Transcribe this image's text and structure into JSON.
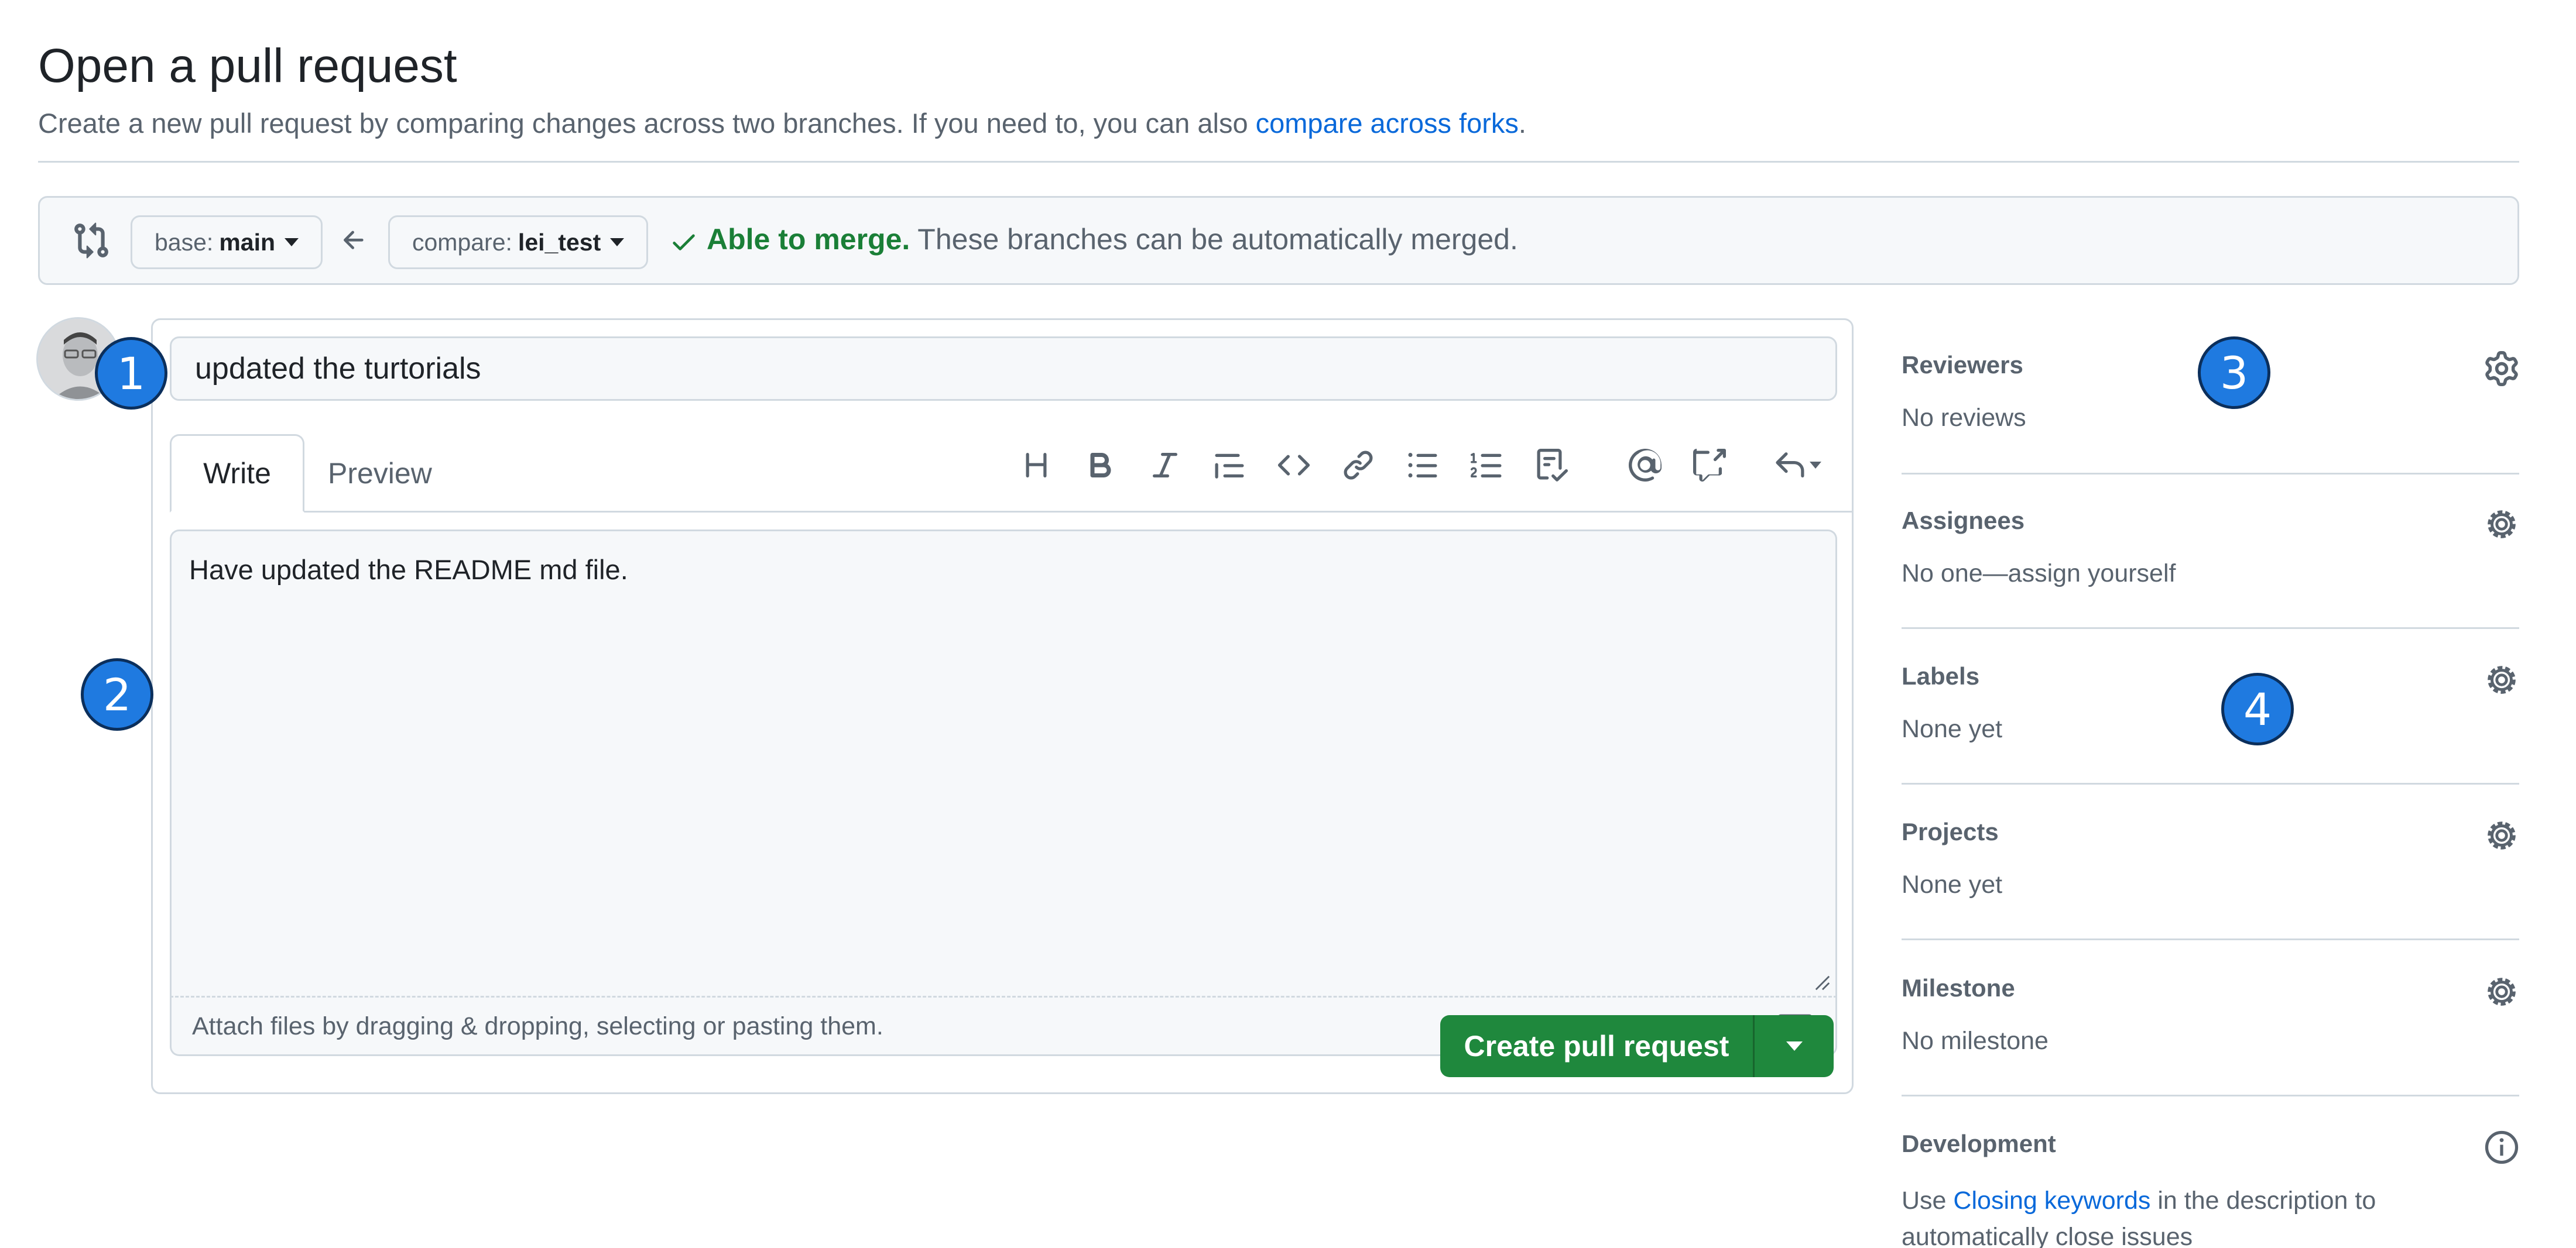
{
  "header": {
    "title": "Open a pull request",
    "subtitle": "Create a new pull request by comparing changes across two branches. If you need to, you can also ",
    "subtitle_link": "compare across forks",
    "subtitle_end": "."
  },
  "compare": {
    "base_label": "base:",
    "base_branch": "main",
    "compare_label": "compare:",
    "compare_branch": "lei_test",
    "merge_ok": "Able to merge.",
    "merge_msg": "These branches can be automatically merged."
  },
  "editor": {
    "title_value": "updated the turtorials",
    "tabs": [
      "Write",
      "Preview"
    ],
    "toolbar": [
      "heading-icon",
      "bold-icon",
      "italic-icon",
      "quote-icon",
      "code-icon",
      "link-icon",
      "unordered-list-icon",
      "ordered-list-icon",
      "task-list-icon",
      "mention-icon",
      "reference-icon",
      "undo-icon"
    ],
    "body_value": "Have updated the README md file.",
    "attach_hint": "Attach files by dragging & dropping, selecting or pasting them.",
    "submit_label": "Create pull request"
  },
  "badges": [
    "1",
    "2",
    "3",
    "4"
  ],
  "sidebar": {
    "sections": [
      {
        "title": "Reviewers",
        "value": "No reviews"
      },
      {
        "title": "Assignees",
        "value": "No one—assign yourself"
      },
      {
        "title": "Labels",
        "value": "None yet"
      },
      {
        "title": "Projects",
        "value": "None yet"
      },
      {
        "title": "Milestone",
        "value": "No milestone"
      }
    ],
    "development": {
      "title": "Development",
      "prefix": "Use ",
      "link": "Closing keywords",
      "suffix": " in the description to",
      "line2": "automatically close issues"
    }
  },
  "colors": {
    "accent_link": "#0969da",
    "success": "#1a7f37",
    "primary_button": "#1f883d",
    "badge": "#1f7ae0"
  }
}
